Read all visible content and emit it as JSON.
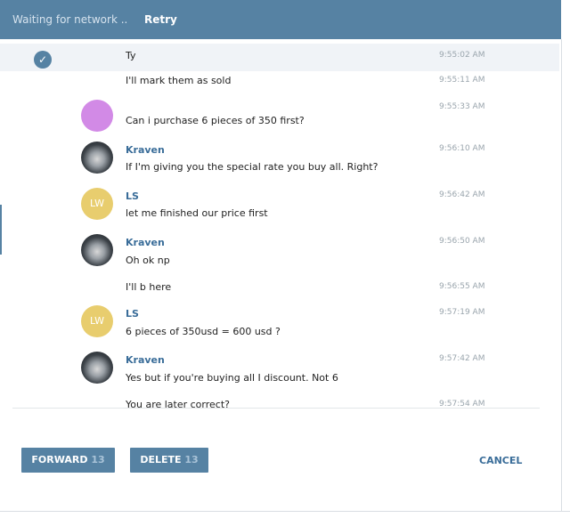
{
  "topbar": {
    "status": "Waiting for network ..",
    "retry": "Retry"
  },
  "messages": [
    {
      "text": "Ty",
      "time": "9:55:02 AM",
      "selected": true
    },
    {
      "text": "I'll mark them as sold",
      "time": "9:55:11 AM"
    },
    {
      "text": "Can i purchase 6 pieces of 350 first?",
      "time": "9:55:33 AM"
    },
    {
      "sender": "Kraven",
      "text": "If I'm giving you the special rate you buy all. Right?",
      "time": "9:56:10 AM"
    },
    {
      "sender": "LS",
      "avatar": "LW",
      "text": "let me finished our price first",
      "time": "9:56:42 AM"
    },
    {
      "sender": "Kraven",
      "text": "Oh ok np",
      "time": "9:56:50 AM"
    },
    {
      "text": "I'll b here",
      "time": "9:56:55 AM"
    },
    {
      "sender": "LS",
      "avatar": "LW",
      "text": "6 pieces of 350usd = 600 usd ?",
      "time": "9:57:19 AM"
    },
    {
      "sender": "Kraven",
      "text": "Yes but if you're buying all I discount. Not 6",
      "time": "9:57:42 AM"
    },
    {
      "text": "You are later correct?",
      "time": "9:57:54 AM"
    }
  ],
  "footer": {
    "forward_label": "FORWARD",
    "forward_count": "13",
    "delete_label": "DELETE",
    "delete_count": "13",
    "cancel_label": "CANCEL"
  },
  "colors": {
    "accent": "#5682a3",
    "name": "#3a6d99",
    "lw_avatar": "#e8cd6e",
    "pink_avatar": "#d28ae6"
  }
}
